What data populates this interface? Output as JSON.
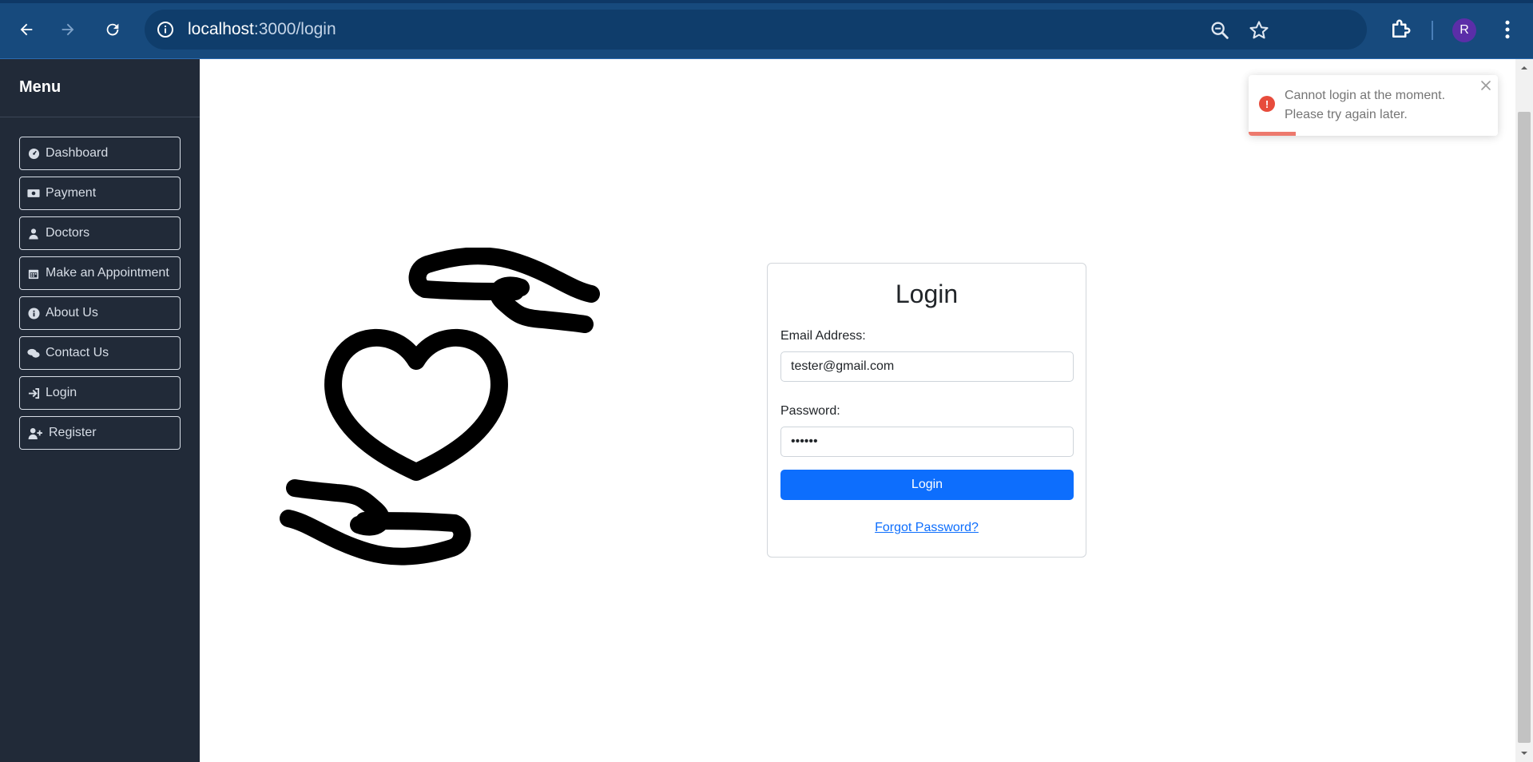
{
  "browser": {
    "url_host": "localhost",
    "url_path": ":3000/login",
    "avatar_initial": "R",
    "icons": [
      "back-icon",
      "forward-icon",
      "reload-icon",
      "site-info-icon",
      "zoom-icon",
      "bookmark-star-icon",
      "extensions-icon",
      "kebab-menu-icon"
    ]
  },
  "sidebar": {
    "title": "Menu",
    "items": [
      {
        "label": "Dashboard",
        "icon": "dashboard-icon"
      },
      {
        "label": "Payment",
        "icon": "money-bill-icon"
      },
      {
        "label": "Doctors",
        "icon": "user-doctor-icon"
      },
      {
        "label": "Make an Appointment",
        "icon": "calendar-icon"
      },
      {
        "label": "About Us",
        "icon": "info-circle-icon"
      },
      {
        "label": "Contact Us",
        "icon": "comments-icon"
      },
      {
        "label": "Login",
        "icon": "sign-in-icon"
      },
      {
        "label": "Register",
        "icon": "user-plus-icon"
      }
    ]
  },
  "login": {
    "title": "Login",
    "email_label": "Email Address:",
    "email_value": "tester@gmail.com",
    "password_label": "Password:",
    "password_value": "••••••",
    "submit_label": "Login",
    "forgot_label": "Forgot Password?"
  },
  "toast": {
    "message": "Cannot login at the moment. Please try again later.",
    "progress_fraction": 0.19,
    "accent_color": "#e74c3c"
  },
  "colors": {
    "primary": "#0d6efd",
    "sidebar_bg": "#212a38",
    "chrome_bg": "#174a7d"
  }
}
